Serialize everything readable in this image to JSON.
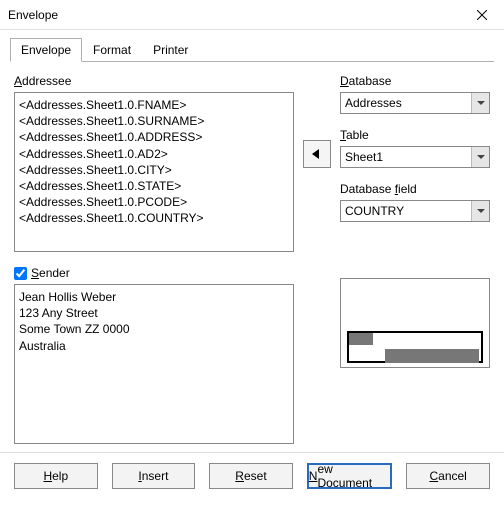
{
  "window": {
    "title": "Envelope"
  },
  "tabs": {
    "envelope": "Envelope",
    "format": "Format",
    "printer": "Printer"
  },
  "labels": {
    "addressee": "Addressee",
    "sender": "Sender",
    "database": "Database",
    "table": "Table",
    "database_field": "Database field"
  },
  "addressee_text": "<Addresses.Sheet1.0.FNAME>\n<Addresses.Sheet1.0.SURNAME>\n<Addresses.Sheet1.0.ADDRESS>\n<Addresses.Sheet1.0.AD2>\n<Addresses.Sheet1.0.CITY>\n<Addresses.Sheet1.0.STATE>\n<Addresses.Sheet1.0.PCODE>\n<Addresses.Sheet1.0.COUNTRY>",
  "sender_checked": true,
  "sender_text": "Jean Hollis Weber\n123 Any Street\nSome Town ZZ 0000\nAustralia",
  "database": {
    "value": "Addresses"
  },
  "table": {
    "value": "Sheet1"
  },
  "field": {
    "value": "COUNTRY"
  },
  "buttons": {
    "help": "Help",
    "insert": "Insert",
    "reset": "Reset",
    "new_document": "New Document",
    "cancel": "Cancel"
  }
}
